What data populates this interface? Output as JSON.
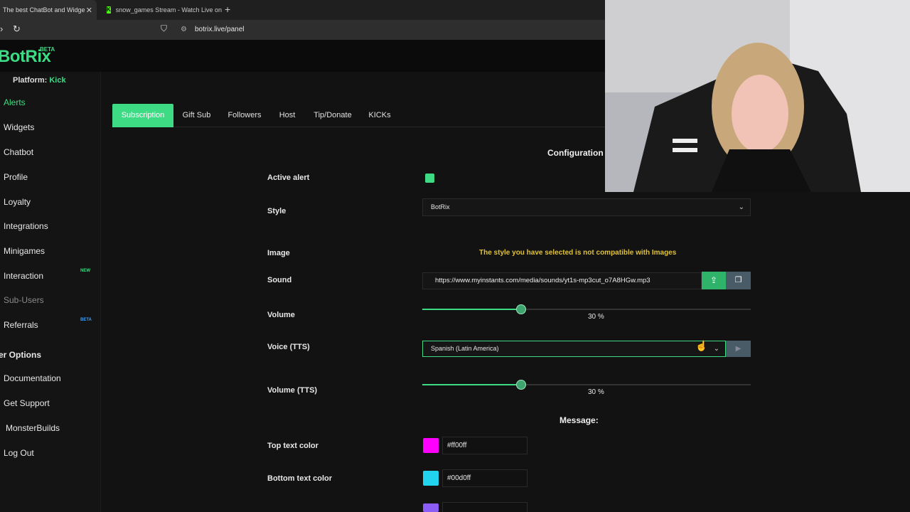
{
  "browser": {
    "tabs": [
      {
        "title": "The best ChatBot and Widge"
      },
      {
        "title": "snow_games Stream - Watch Live on"
      }
    ],
    "url": "botrix.live/panel"
  },
  "app": {
    "logo": "BotRix",
    "logo_badge": "BETA",
    "platform_label": "Platform:",
    "platform_value": "Kick"
  },
  "sidebar": {
    "items": [
      {
        "label": "Alerts"
      },
      {
        "label": "Widgets"
      },
      {
        "label": "Chatbot"
      },
      {
        "label": "Profile"
      },
      {
        "label": "Loyalty"
      },
      {
        "label": "Integrations"
      },
      {
        "label": "Minigames"
      },
      {
        "label": "Interaction",
        "badge": "NEW"
      },
      {
        "label": "Sub-Users"
      },
      {
        "label": "Referrals",
        "badge": "BETA"
      },
      {
        "label": "er Options"
      },
      {
        "label": "Documentation"
      },
      {
        "label": "Get Support"
      },
      {
        "label": "MonsterBuilds"
      },
      {
        "label": "Log Out"
      }
    ]
  },
  "alert_tabs": [
    "Subscription",
    "Gift Sub",
    "Followers",
    "Host",
    "Tip/Donate",
    "KICKs"
  ],
  "config": {
    "title": "Configuration",
    "active_alert_label": "Active alert",
    "active_alert_checked": true,
    "style_label": "Style",
    "style_value": "BotRix",
    "image_label": "Image",
    "image_warning": "The style you have selected is not compatible with Images",
    "sound_label": "Sound",
    "sound_value": "https://www.myinstants.com/media/sounds/yt1s-mp3cut_o7A8HGw.mp3",
    "volume_label": "Volume",
    "volume_value": 30,
    "volume_text": "30 %",
    "voice_label": "Voice (TTS)",
    "voice_value": "Spanish (Latin America)",
    "volume_tts_label": "Volume (TTS)",
    "volume_tts_value": 30,
    "volume_tts_text": "30 %",
    "message_title": "Message:",
    "top_color_label": "Top text color",
    "top_color_value": "#ff00ff",
    "bottom_color_label": "Bottom text color",
    "bottom_color_value": "#00d0ff"
  },
  "colors": {
    "accent": "#3ddc84",
    "warning": "#e0c23a",
    "top_swatch": "#ff00ff",
    "bottom_swatch": "#22d3ee",
    "partial_swatch": "#8b5cf6"
  }
}
